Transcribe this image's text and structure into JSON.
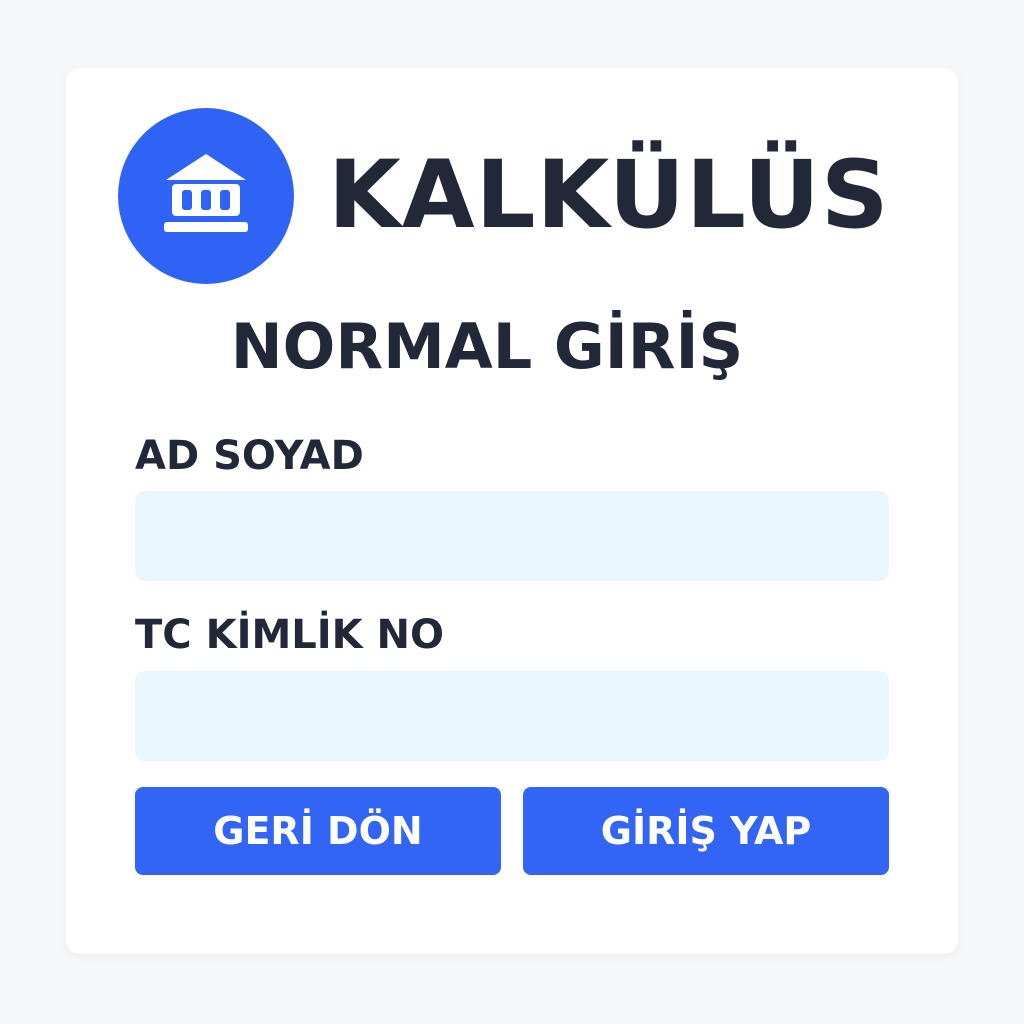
{
  "brand": {
    "name": "KALKÜLÜS",
    "logo_icon": "bank-building-icon",
    "logo_color": "#2f63f5"
  },
  "heading": "NORMAL GİRİŞ",
  "form": {
    "name_label": "AD SOYAD",
    "name_value": "",
    "id_label": "TC KİMLİK NO",
    "id_value": ""
  },
  "buttons": {
    "back_label": "GERİ DÖN",
    "login_label": "GİRİŞ YAP",
    "color": "#3264f6"
  }
}
